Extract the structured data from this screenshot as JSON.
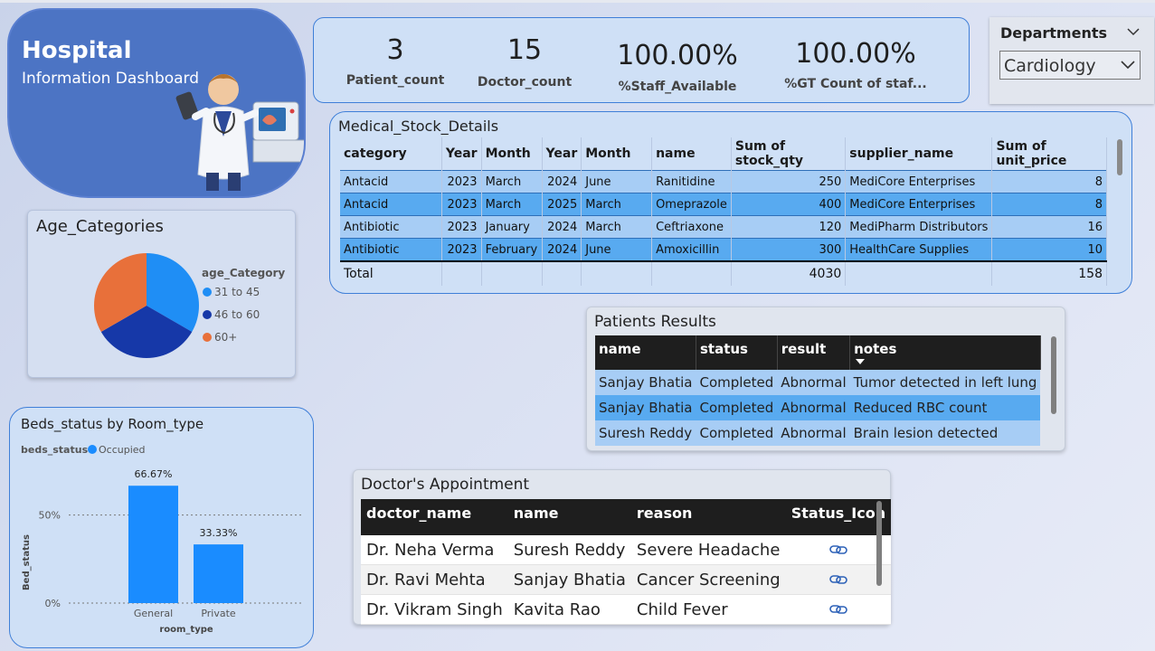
{
  "header": {
    "title": "Hospital",
    "subtitle": "Information Dashboard"
  },
  "kpis": [
    {
      "value": "3",
      "label": "Patient_count"
    },
    {
      "value": "15",
      "label": "Doctor_count"
    },
    {
      "value": "100.00%",
      "label": "%Staff_Available"
    },
    {
      "value": "100.00%",
      "label": "%GT Count of staf..."
    }
  ],
  "departments": {
    "title": "Departments",
    "selected": "Cardiology"
  },
  "stock": {
    "title": "Medical_Stock_Details",
    "columns": [
      "category",
      "Year",
      "Month",
      "Year",
      "Month",
      "name",
      "Sum of stock_qty",
      "supplier_name",
      "Sum of unit_price"
    ],
    "rows": [
      [
        "Antacid",
        "2023",
        "March",
        "2024",
        "June",
        "Ranitidine",
        "250",
        "MediCore Enterprises",
        "8"
      ],
      [
        "Antacid",
        "2023",
        "March",
        "2025",
        "March",
        "Omeprazole",
        "400",
        "MediCore Enterprises",
        "8"
      ],
      [
        "Antibiotic",
        "2023",
        "January",
        "2024",
        "March",
        "Ceftriaxone",
        "120",
        "MediPharm Distributors",
        "16"
      ],
      [
        "Antibiotic",
        "2023",
        "February",
        "2024",
        "June",
        "Amoxicillin",
        "300",
        "HealthCare Supplies",
        "10"
      ]
    ],
    "total": {
      "label": "Total",
      "stock_qty": "4030",
      "unit_price": "158"
    }
  },
  "chart_data": [
    {
      "type": "pie",
      "title": "Age_Categories",
      "legend_title": "age_Category",
      "legend_position": "right",
      "slices": [
        {
          "label": "31 to 45",
          "value": 33.33,
          "color": "#1f8ef5"
        },
        {
          "label": "46 to 60",
          "value": 33.33,
          "color": "#1638a8"
        },
        {
          "label": "60+",
          "value": 33.34,
          "color": "#e8703a"
        }
      ]
    },
    {
      "type": "bar",
      "title": "Beds_status by Room_type",
      "legend_title": "beds_status",
      "legend_position": "top-left",
      "series": [
        {
          "name": "Occupied",
          "values": [
            66.67,
            33.33
          ],
          "color": "#1a8cff"
        }
      ],
      "categories": [
        "General",
        "Private"
      ],
      "data_labels": [
        "66.67%",
        "33.33%"
      ],
      "xlabel": "room_type",
      "ylabel": "Bed_status",
      "yticks": [
        "0%",
        "50%"
      ],
      "ylim": [
        0,
        75
      ],
      "grid": true
    }
  ],
  "patients": {
    "title": "Patients Results",
    "columns": [
      "name",
      "status",
      "result",
      "notes"
    ],
    "rows": [
      [
        "Sanjay Bhatia",
        "Completed",
        "Abnormal",
        "Tumor detected in left lung"
      ],
      [
        "Sanjay Bhatia",
        "Completed",
        "Abnormal",
        "Reduced RBC count"
      ],
      [
        "Suresh Reddy",
        "Completed",
        "Abnormal",
        "Brain lesion detected"
      ]
    ]
  },
  "appointments": {
    "title": "Doctor's Appointment",
    "columns": [
      "doctor_name",
      "name",
      "reason",
      "Status_Icon"
    ],
    "rows": [
      [
        "Dr. Neha Verma",
        "Suresh Reddy",
        "Severe Headache",
        "link-icon"
      ],
      [
        "Dr. Ravi Mehta",
        "Sanjay Bhatia",
        "Cancer Screening",
        "link-icon"
      ],
      [
        "Dr. Vikram Singh",
        "Kavita Rao",
        "Child Fever",
        "link-icon"
      ]
    ]
  }
}
